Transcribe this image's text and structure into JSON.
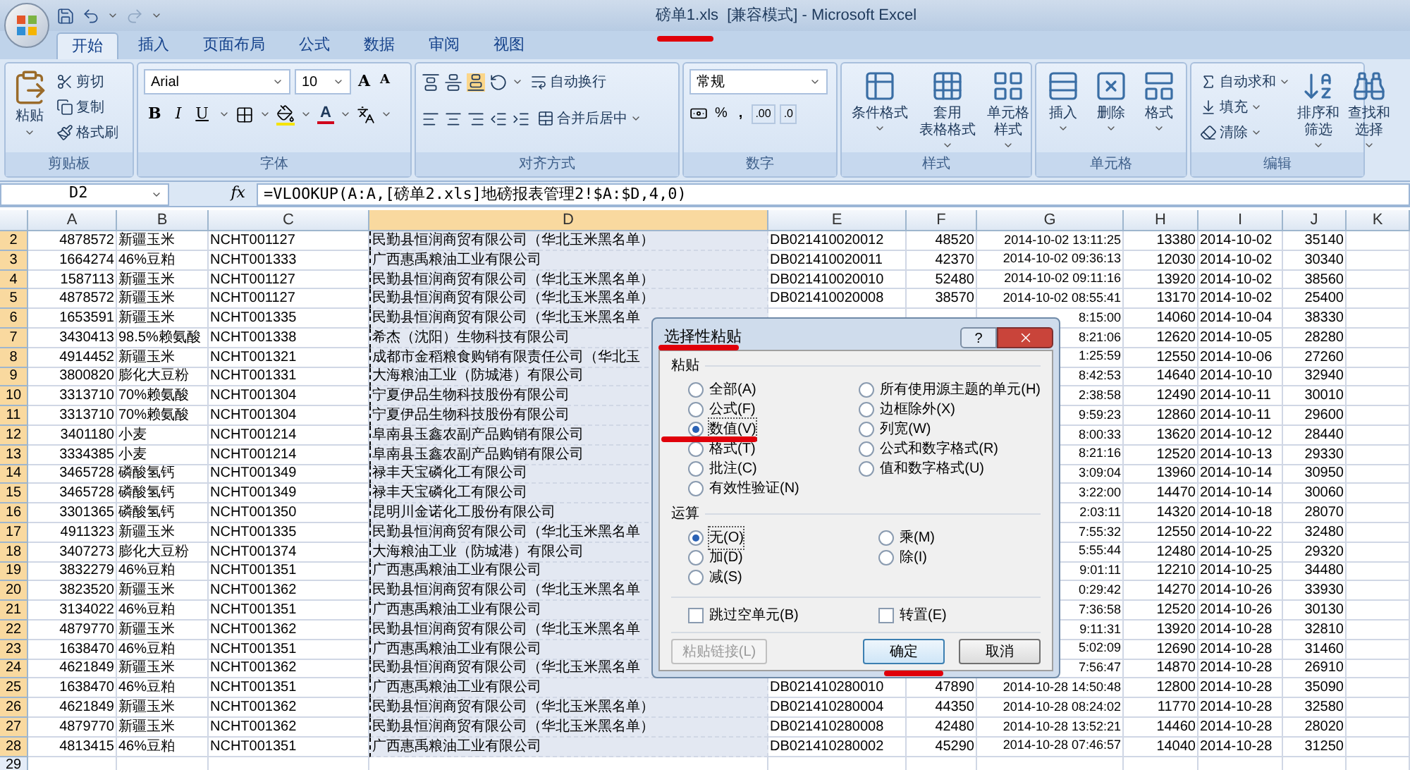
{
  "window": {
    "title": "磅单1.xls  [兼容模式] - Microsoft Excel"
  },
  "tabs": [
    {
      "label": "开始",
      "selected": true
    },
    {
      "label": "插入",
      "selected": false
    },
    {
      "label": "页面布局",
      "selected": false
    },
    {
      "label": "公式",
      "selected": false
    },
    {
      "label": "数据",
      "selected": false
    },
    {
      "label": "审阅",
      "selected": false
    },
    {
      "label": "视图",
      "selected": false
    }
  ],
  "ribbon": {
    "clipboard": {
      "label": "剪贴板",
      "paste": "粘贴",
      "cut": "剪切",
      "copy": "复制",
      "format_painter": "格式刷"
    },
    "font": {
      "label": "字体",
      "font_name": "Arial",
      "font_size": "10",
      "grow": "A",
      "shrink": "A",
      "bold": "B",
      "italic": "I",
      "underline": "U",
      "font_color": "A"
    },
    "alignment": {
      "label": "对齐方式",
      "wrap": "自动换行",
      "merge": "合并后居中"
    },
    "number": {
      "label": "数字",
      "format": "常规",
      "percent": "%",
      "comma": ",",
      "decimals": [
        ".00",
        ".0"
      ]
    },
    "styles": {
      "label": "样式",
      "items": [
        {
          "line1": "条件格式"
        },
        {
          "line1": "套用",
          "line2": "表格格式"
        },
        {
          "line1": "单元格",
          "line2": "样式"
        }
      ]
    },
    "cells": {
      "label": "单元格",
      "items": [
        "插入",
        "删除",
        "格式"
      ]
    },
    "editing": {
      "label": "编辑",
      "autosum": "自动求和",
      "fill": "填充",
      "clear": "清除",
      "sort": [
        "排序和",
        "筛选"
      ],
      "find": [
        "查找和",
        "选择"
      ]
    }
  },
  "formula_bar": {
    "name_box": "D2",
    "function_label": "fx",
    "formula": "=VLOOKUP(A:A,[磅单2.xls]地磅报表管理2!$A:$D,4,0)"
  },
  "columns": [
    {
      "label": "A",
      "selected": false
    },
    {
      "label": "B",
      "selected": false
    },
    {
      "label": "C",
      "selected": false
    },
    {
      "label": "D",
      "selected": true
    },
    {
      "label": "E",
      "selected": false
    },
    {
      "label": "F",
      "selected": false
    },
    {
      "label": "G",
      "selected": false
    },
    {
      "label": "H",
      "selected": false
    },
    {
      "label": "I",
      "selected": false
    },
    {
      "label": "J",
      "selected": false
    },
    {
      "label": "K",
      "selected": false
    }
  ],
  "rows": [
    {
      "num": "2",
      "selected": true,
      "cells": [
        "4878572",
        "新疆玉米",
        "NCHT001127",
        "民勤县恒润商贸有限公司（华北玉米黑名单）",
        "DB021410020012",
        "48520",
        "2014-10-02 13:11:25",
        "13380",
        "2014-10-02",
        "35140"
      ]
    },
    {
      "num": "3",
      "selected": true,
      "cells": [
        "1664274",
        "46%豆粕",
        "NCHT001333",
        "广西惠禹粮油工业有限公司",
        "DB021410020011",
        "42370",
        "2014-10-02 09:36:13",
        "12030",
        "2014-10-02",
        "30340"
      ]
    },
    {
      "num": "4",
      "selected": true,
      "cells": [
        "1587113",
        "新疆玉米",
        "NCHT001127",
        "民勤县恒润商贸有限公司（华北玉米黑名单）",
        "DB021410020010",
        "52480",
        "2014-10-02 09:11:16",
        "13920",
        "2014-10-02",
        "38560"
      ]
    },
    {
      "num": "5",
      "selected": true,
      "cells": [
        "4878572",
        "新疆玉米",
        "NCHT001127",
        "民勤县恒润商贸有限公司（华北玉米黑名单）",
        "DB021410020008",
        "38570",
        "2014-10-02 08:55:41",
        "13170",
        "2014-10-02",
        "25400"
      ]
    },
    {
      "num": "6",
      "selected": true,
      "cells": [
        "1653591",
        "新疆玉米",
        "NCHT001335",
        "民勤县恒润商贸有限公司（华北玉米黑名单",
        null,
        null,
        "8:15:00",
        "14060",
        "2014-10-04",
        "38330"
      ]
    },
    {
      "num": "7",
      "selected": true,
      "cells": [
        "3430413",
        "98.5%赖氨酸",
        "NCHT001338",
        "希杰（沈阳）生物科技有限公司",
        null,
        null,
        "8:21:06",
        "12620",
        "2014-10-05",
        "28280"
      ]
    },
    {
      "num": "8",
      "selected": true,
      "cells": [
        "4914452",
        "新疆玉米",
        "NCHT001321",
        "成都市金稻粮食购销有限责任公司（华北玉",
        null,
        null,
        "1:25:59",
        "12550",
        "2014-10-06",
        "27260"
      ]
    },
    {
      "num": "9",
      "selected": true,
      "cells": [
        "3800820",
        "膨化大豆粉",
        "NCHT001331",
        "大海粮油工业（防城港）有限公司",
        null,
        null,
        "8:42:53",
        "14640",
        "2014-10-10",
        "32940"
      ]
    },
    {
      "num": "10",
      "selected": true,
      "cells": [
        "3313710",
        "70%赖氨酸",
        "NCHT001304",
        "宁夏伊品生物科技股份有限公司",
        null,
        null,
        "2:38:58",
        "12490",
        "2014-10-11",
        "30010"
      ]
    },
    {
      "num": "11",
      "selected": true,
      "cells": [
        "3313710",
        "70%赖氨酸",
        "NCHT001304",
        "宁夏伊品生物科技股份有限公司",
        null,
        null,
        "9:59:23",
        "12860",
        "2014-10-11",
        "29600"
      ]
    },
    {
      "num": "12",
      "selected": true,
      "cells": [
        "3401180",
        "小麦",
        "NCHT001214",
        "阜南县玉鑫农副产品购销有限公司",
        null,
        null,
        "8:00:33",
        "13620",
        "2014-10-12",
        "28440"
      ]
    },
    {
      "num": "13",
      "selected": true,
      "cells": [
        "3334385",
        "小麦",
        "NCHT001214",
        "阜南县玉鑫农副产品购销有限公司",
        null,
        null,
        "8:21:16",
        "12520",
        "2014-10-13",
        "29330"
      ]
    },
    {
      "num": "14",
      "selected": true,
      "cells": [
        "3465728",
        "磷酸氢钙",
        "NCHT001349",
        "禄丰天宝磷化工有限公司",
        null,
        null,
        "3:09:04",
        "13960",
        "2014-10-14",
        "30950"
      ]
    },
    {
      "num": "15",
      "selected": true,
      "cells": [
        "3465728",
        "磷酸氢钙",
        "NCHT001349",
        "禄丰天宝磷化工有限公司",
        null,
        null,
        "3:22:00",
        "14470",
        "2014-10-14",
        "30060"
      ]
    },
    {
      "num": "16",
      "selected": true,
      "cells": [
        "3301365",
        "磷酸氢钙",
        "NCHT001350",
        "昆明川金诺化工股份有限公司",
        null,
        null,
        "2:03:11",
        "14320",
        "2014-10-18",
        "28070"
      ]
    },
    {
      "num": "17",
      "selected": true,
      "cells": [
        "4911323",
        "新疆玉米",
        "NCHT001335",
        "民勤县恒润商贸有限公司（华北玉米黑名单",
        null,
        null,
        "7:55:32",
        "12550",
        "2014-10-22",
        "32480"
      ]
    },
    {
      "num": "18",
      "selected": true,
      "cells": [
        "3407273",
        "膨化大豆粉",
        "NCHT001374",
        "大海粮油工业（防城港）有限公司",
        null,
        null,
        "5:55:44",
        "12480",
        "2014-10-25",
        "29320"
      ]
    },
    {
      "num": "19",
      "selected": true,
      "cells": [
        "3832279",
        "46%豆粕",
        "NCHT001351",
        "广西惠禹粮油工业有限公司",
        null,
        null,
        "9:01:11",
        "12210",
        "2014-10-25",
        "34480"
      ]
    },
    {
      "num": "20",
      "selected": true,
      "cells": [
        "3823520",
        "新疆玉米",
        "NCHT001362",
        "民勤县恒润商贸有限公司（华北玉米黑名单",
        null,
        null,
        "0:29:42",
        "14270",
        "2014-10-26",
        "33930"
      ]
    },
    {
      "num": "21",
      "selected": true,
      "cells": [
        "3134022",
        "46%豆粕",
        "NCHT001351",
        "广西惠禹粮油工业有限公司",
        null,
        null,
        "7:36:58",
        "12520",
        "2014-10-26",
        "30130"
      ]
    },
    {
      "num": "22",
      "selected": true,
      "cells": [
        "4879770",
        "新疆玉米",
        "NCHT001362",
        "民勤县恒润商贸有限公司（华北玉米黑名单",
        null,
        null,
        "9:11:31",
        "13920",
        "2014-10-28",
        "32810"
      ]
    },
    {
      "num": "23",
      "selected": true,
      "cells": [
        "1638470",
        "46%豆粕",
        "NCHT001351",
        "广西惠禹粮油工业有限公司",
        null,
        null,
        "5:02:09",
        "12690",
        "2014-10-28",
        "31460"
      ]
    },
    {
      "num": "24",
      "selected": true,
      "cells": [
        "4621849",
        "新疆玉米",
        "NCHT001362",
        "民勤县恒润商贸有限公司（华北玉米黑名单",
        null,
        null,
        "7:56:47",
        "14870",
        "2014-10-28",
        "26910"
      ]
    },
    {
      "num": "25",
      "selected": true,
      "cells": [
        "1638470",
        "46%豆粕",
        "NCHT001351",
        "广西惠禹粮油工业有限公司",
        "DB021410280010",
        "47890",
        "2014-10-28 14:50:48",
        "12800",
        "2014-10-28",
        "35090"
      ]
    },
    {
      "num": "26",
      "selected": true,
      "cells": [
        "4621849",
        "新疆玉米",
        "NCHT001362",
        "民勤县恒润商贸有限公司（华北玉米黑名单）",
        "DB021410280004",
        "44350",
        "2014-10-28 08:24:02",
        "11770",
        "2014-10-28",
        "32580"
      ]
    },
    {
      "num": "27",
      "selected": true,
      "cells": [
        "4879770",
        "新疆玉米",
        "NCHT001362",
        "民勤县恒润商贸有限公司（华北玉米黑名单）",
        "DB021410280008",
        "42480",
        "2014-10-28 13:52:21",
        "14460",
        "2014-10-28",
        "28020"
      ]
    },
    {
      "num": "28",
      "selected": true,
      "cells": [
        "4813415",
        "46%豆粕",
        "NCHT001351",
        "广西惠禹粮油工业有限公司",
        "DB021410280002",
        "45290",
        "2014-10-28 07:46:57",
        "14040",
        "2014-10-28",
        "31250"
      ]
    },
    {
      "num": "29",
      "selected": false,
      "cells": []
    }
  ],
  "dialog": {
    "title": "选择性粘贴",
    "help": "?",
    "paste": {
      "label": "粘贴",
      "columns": [
        [
          {
            "label": "全部(A)",
            "selected": false
          },
          {
            "label": "公式(F)",
            "selected": false
          },
          {
            "label": "数值(V)",
            "selected": true
          },
          {
            "label": "格式(T)",
            "selected": false
          },
          {
            "label": "批注(C)",
            "selected": false
          },
          {
            "label": "有效性验证(N)",
            "selected": false
          }
        ],
        [
          {
            "label": "所有使用源主题的单元(H)",
            "selected": false
          },
          {
            "label": "边框除外(X)",
            "selected": false
          },
          {
            "label": "列宽(W)",
            "selected": false
          },
          {
            "label": "公式和数字格式(R)",
            "selected": false
          },
          {
            "label": "值和数字格式(U)",
            "selected": false
          }
        ]
      ]
    },
    "operation": {
      "label": "运算",
      "columns": [
        [
          {
            "label": "无(O)",
            "selected": true
          },
          {
            "label": "加(D)",
            "selected": false
          },
          {
            "label": "减(S)",
            "selected": false
          }
        ],
        [
          {
            "label": "乘(M)",
            "selected": false
          },
          {
            "label": "除(I)",
            "selected": false
          }
        ]
      ]
    },
    "checkboxes": [
      {
        "label": "跳过空单元(B)",
        "checked": false
      },
      {
        "label": "转置(E)",
        "checked": false
      }
    ],
    "buttons": [
      {
        "label": "粘贴链接(L)",
        "disabled": true,
        "kind": "link"
      },
      {
        "label": "确定",
        "disabled": false,
        "kind": "ok"
      },
      {
        "label": "取消",
        "disabled": false,
        "kind": "cancel"
      }
    ]
  }
}
